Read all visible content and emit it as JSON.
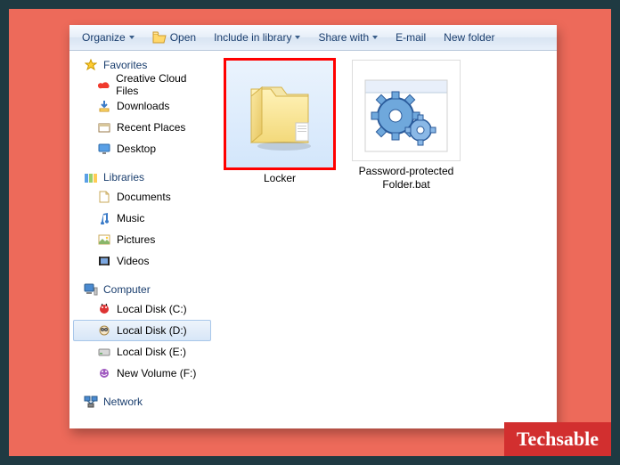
{
  "toolbar": {
    "organize": "Organize",
    "open": "Open",
    "include": "Include in library",
    "share": "Share with",
    "email": "E-mail",
    "newfolder": "New folder"
  },
  "nav": {
    "favorites": "Favorites",
    "fav_items": [
      "Creative Cloud Files",
      "Downloads",
      "Recent Places",
      "Desktop"
    ],
    "libraries": "Libraries",
    "lib_items": [
      "Documents",
      "Music",
      "Pictures",
      "Videos"
    ],
    "computer": "Computer",
    "drives": [
      "Local Disk (C:)",
      "Local Disk (D:)",
      "Local Disk (E:)",
      "New Volume (F:)"
    ],
    "network": "Network"
  },
  "items": {
    "folder": "Locker",
    "bat": "Password-protected Folder.bat"
  },
  "watermark": "Techsable"
}
